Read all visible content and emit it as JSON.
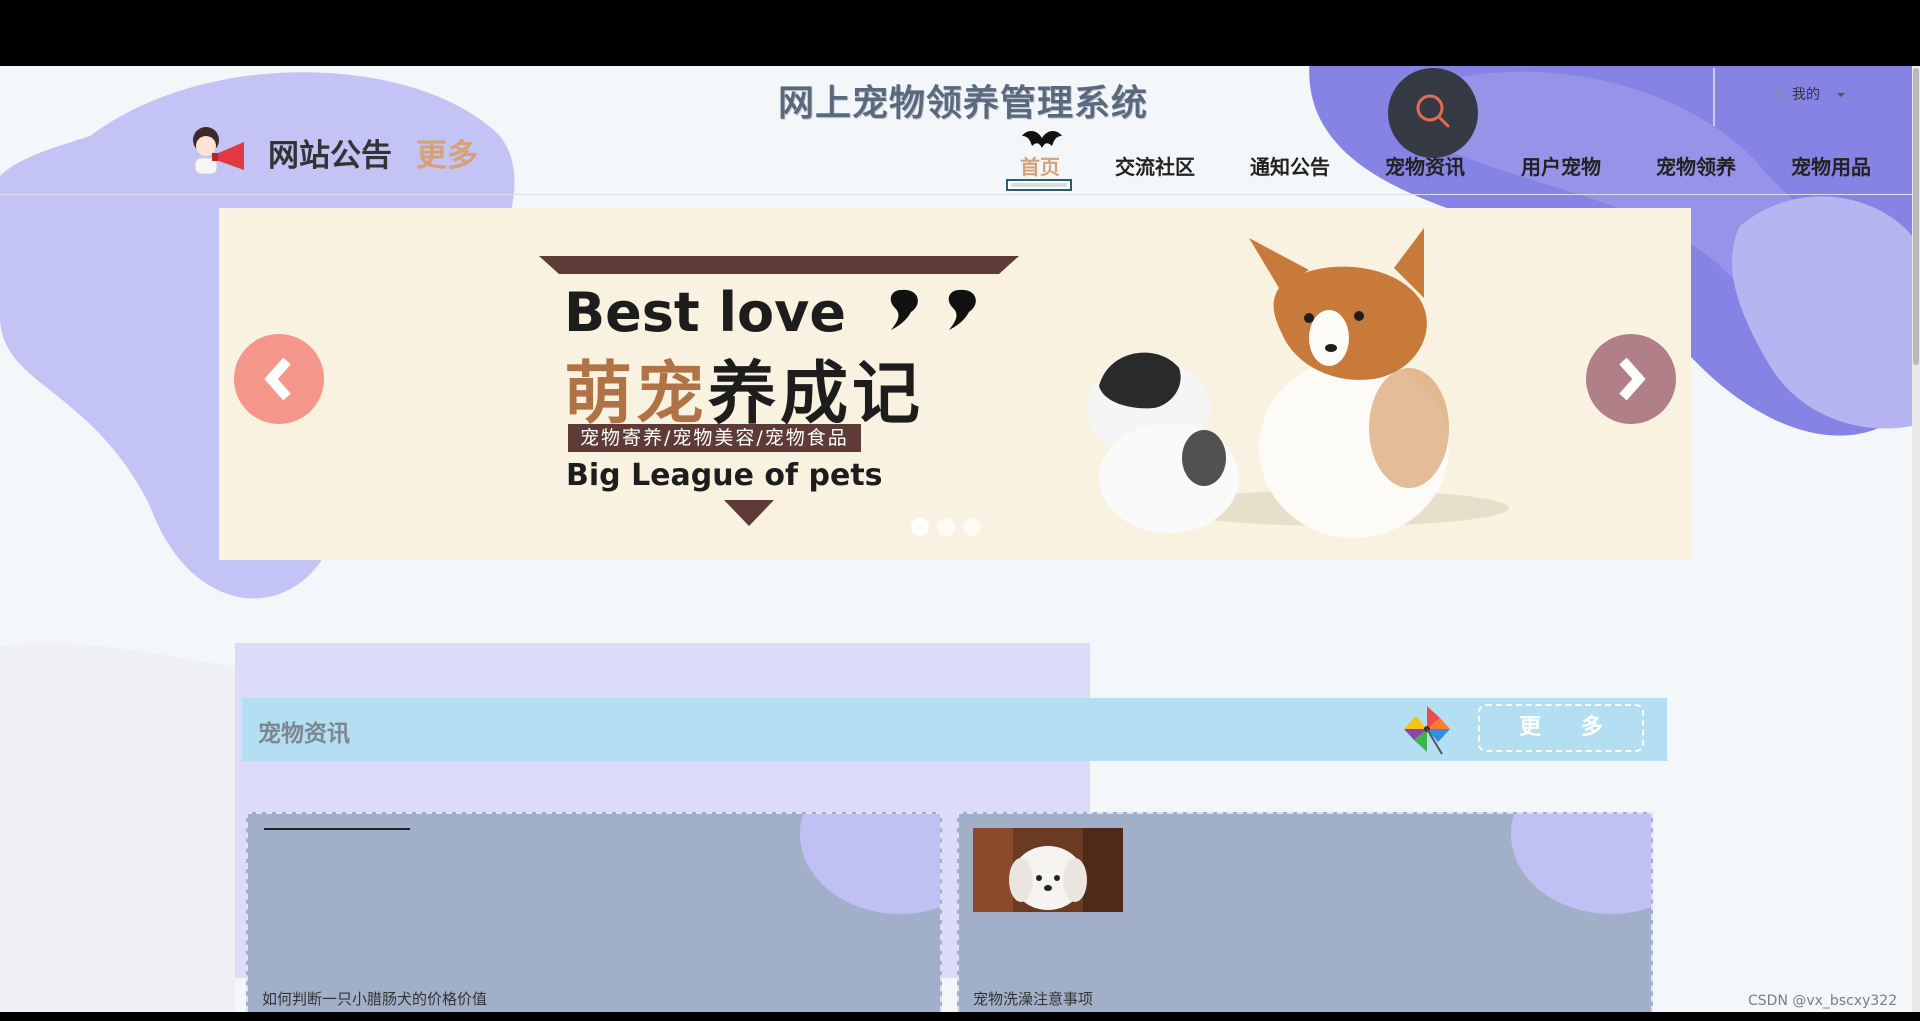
{
  "header": {
    "site_title": "网上宠物领养管理系统",
    "user_label": "我的",
    "notice_title": "网站公告",
    "notice_more": "更多"
  },
  "nav": {
    "items": [
      {
        "label": "首页",
        "active": true
      },
      {
        "label": "交流社区",
        "active": false
      },
      {
        "label": "通知公告",
        "active": false
      },
      {
        "label": "宠物资讯",
        "active": false
      },
      {
        "label": "用户宠物",
        "active": false
      },
      {
        "label": "宠物领养",
        "active": false
      },
      {
        "label": "宠物用品",
        "active": false
      }
    ]
  },
  "banner": {
    "line1": "Best love",
    "line2_accent": "萌宠",
    "line2_dark": "养成记",
    "tagline": "宠物寄养/宠物美容/宠物食品",
    "line3": "Big League of pets",
    "slide_count": 3,
    "active_slide": 1
  },
  "news": {
    "section_title": "宠物资讯",
    "more_label": "更 多",
    "items": [
      {
        "title": "如何判断一只小腊肠犬的价格价值"
      },
      {
        "title": "宠物洗澡注意事项"
      }
    ]
  },
  "watermark": "CSDN @vx_bscxy322",
  "colors": {
    "accent": "#d7a177",
    "nav_active": "#d7a177",
    "news_header": "#b4def1",
    "card_bg": "#a1b0c8",
    "blob_purple": "#c3c3f5",
    "blob_deep": "#7f7fe3"
  },
  "icons": {
    "search": "search-icon",
    "user": "user-icon",
    "notice": "megaphone-girl-icon",
    "bat": "bat-icon",
    "pinwheel": "pinwheel-icon",
    "prev": "chevron-left-icon",
    "next": "chevron-right-icon"
  }
}
